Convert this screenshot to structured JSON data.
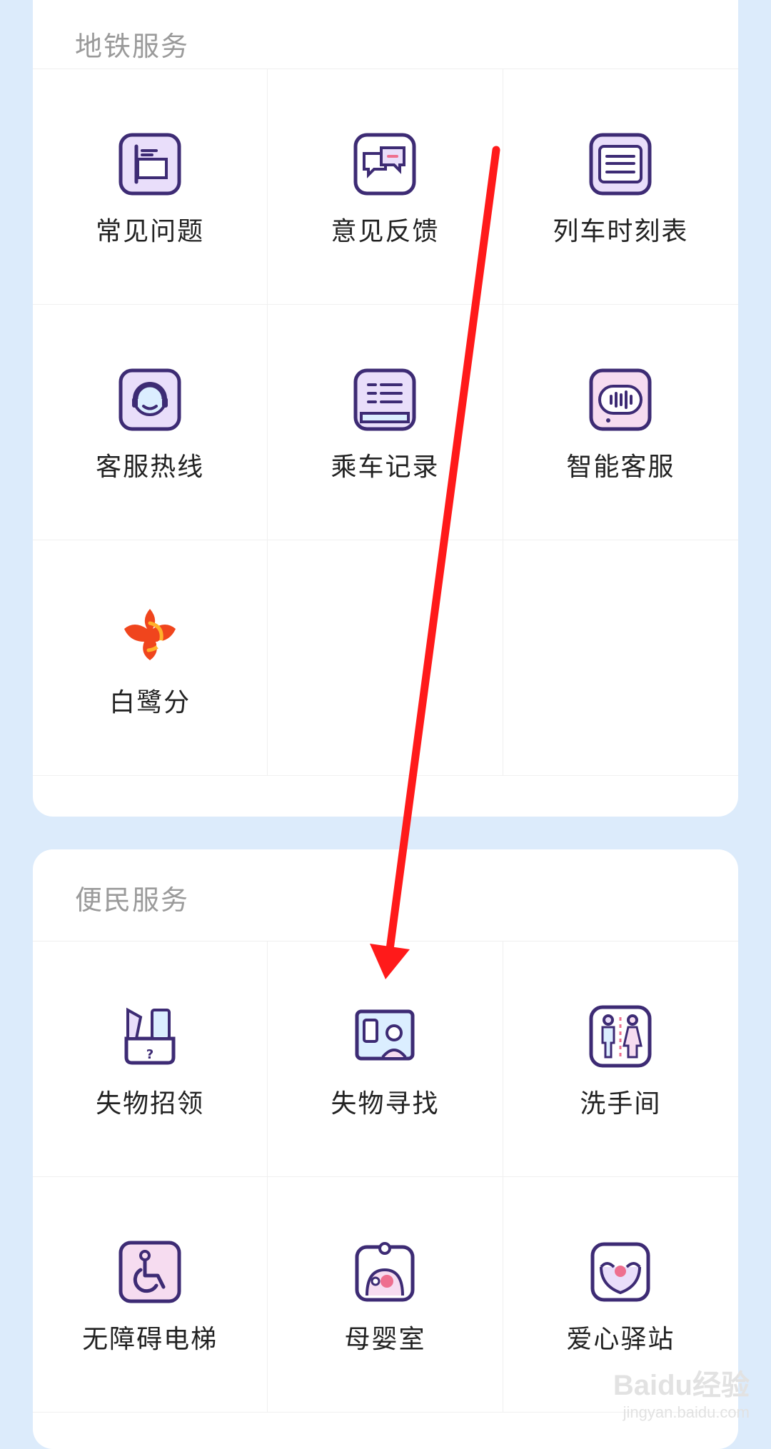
{
  "metro_services": {
    "title": "地铁服务",
    "items": [
      {
        "label": "常见问题",
        "icon": "faq-flag-icon"
      },
      {
        "label": "意见反馈",
        "icon": "feedback-chat-icon"
      },
      {
        "label": "列车时刻表",
        "icon": "timetable-icon"
      },
      {
        "label": "客服热线",
        "icon": "headset-icon"
      },
      {
        "label": "乘车记录",
        "icon": "ride-record-icon"
      },
      {
        "label": "智能客服",
        "icon": "smart-service-icon"
      },
      {
        "label": "白鹭分",
        "icon": "bailu-logo-icon"
      }
    ]
  },
  "convenience_services": {
    "title": "便民服务",
    "items": [
      {
        "label": "失物招领",
        "icon": "lost-and-found-icon"
      },
      {
        "label": "失物寻找",
        "icon": "lost-item-search-icon"
      },
      {
        "label": "洗手间",
        "icon": "restroom-icon"
      },
      {
        "label": "无障碍电梯",
        "icon": "accessible-elevator-icon"
      },
      {
        "label": "母婴室",
        "icon": "nursing-room-icon"
      },
      {
        "label": "爱心驿站",
        "icon": "love-station-icon"
      }
    ]
  },
  "watermark": {
    "brand": "Baidu经验",
    "url": "jingyan.baidu.com"
  },
  "colors": {
    "icon_stroke": "#3d2b74",
    "icon_fill": "#e9defa",
    "accent_pink": "#ee6f8f",
    "arrow": "#ff1a1a"
  }
}
